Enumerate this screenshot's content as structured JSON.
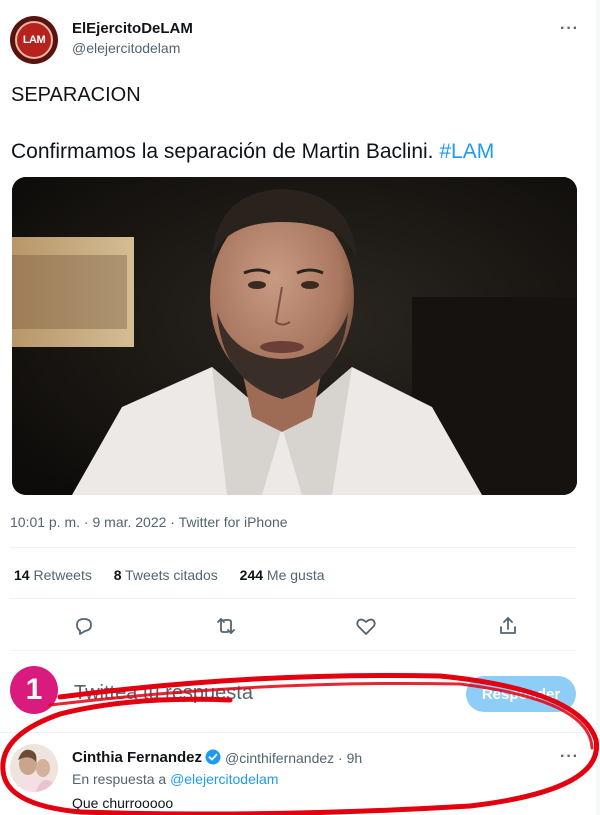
{
  "tweet": {
    "display_name": "ElEjercitoDeLAM",
    "handle": "@elejercitodelam",
    "avatar_text": "LAM",
    "more_label": "···",
    "line1": "SEPARACION",
    "line2_text": "Confirmamos la separación de Martin Baclini.",
    "hashtag": "#LAM",
    "meta": "10:01 p. m. · 9 mar. 2022 · Twitter for iPhone"
  },
  "stats": {
    "retweets_count": "14",
    "retweets_label": "Retweets",
    "quotes_count": "8",
    "quotes_label": "Tweets citados",
    "likes_count": "244",
    "likes_label": "Me gusta"
  },
  "actions": {
    "icons": [
      "reply-icon",
      "retweet-icon",
      "like-icon",
      "share-icon"
    ]
  },
  "compose": {
    "avatar_text": "1",
    "placeholder": "Twittea tu respuesta",
    "reply_button": "Responder"
  },
  "reply": {
    "display_name": "Cinthia Fernandez",
    "handle_time": "@cinthifernandez · 9h",
    "replying_prefix": "En respuesta a",
    "replying_mention": "@elejercitodelam",
    "text": "Que churrooooo",
    "more_label": "···"
  },
  "colors": {
    "accent": "#1d9bf0",
    "annotation": "#e3000f",
    "muted": "#536471"
  }
}
